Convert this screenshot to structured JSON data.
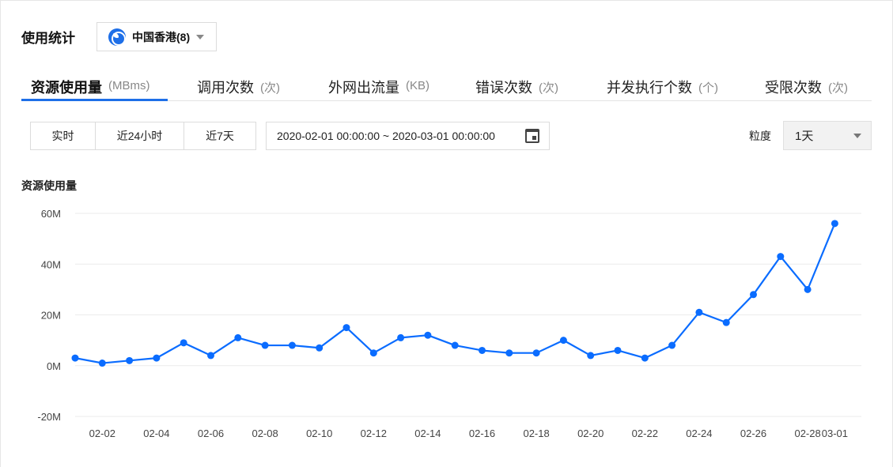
{
  "header": {
    "title": "使用统计"
  },
  "region": {
    "label": "中国香港(8)",
    "icon": "globe-icon"
  },
  "tabs": [
    {
      "label": "资源使用量",
      "unit": "(MBms)",
      "active": true
    },
    {
      "label": "调用次数",
      "unit": "(次)",
      "active": false
    },
    {
      "label": "外网出流量",
      "unit": "(KB)",
      "active": false
    },
    {
      "label": "错误次数",
      "unit": "(次)",
      "active": false
    },
    {
      "label": "并发执行个数",
      "unit": "(个)",
      "active": false
    },
    {
      "label": "受限次数",
      "unit": "(次)",
      "active": false
    }
  ],
  "range_buttons": [
    {
      "label": "实时"
    },
    {
      "label": "近24小时"
    },
    {
      "label": "近7天"
    }
  ],
  "date_range": {
    "value": "2020-02-01 00:00:00 ~ 2020-03-01 00:00:00",
    "icon": "calendar-icon"
  },
  "granularity": {
    "label": "粒度",
    "value": "1天"
  },
  "colors": {
    "accent": "#1e6fe8",
    "line": "#0a6cff",
    "grid": "#ebebeb"
  },
  "chart_data": {
    "type": "line",
    "title": "资源使用量",
    "x_tick_labels": [
      "02-02",
      "02-04",
      "02-06",
      "02-08",
      "02-10",
      "02-12",
      "02-14",
      "02-16",
      "02-18",
      "02-20",
      "02-22",
      "02-24",
      "02-26",
      "02-28",
      "03-01"
    ],
    "y_tick_labels": [
      "60M",
      "40M",
      "20M",
      "0M",
      "-20M"
    ],
    "y_tick_values": [
      60,
      40,
      20,
      0,
      -20
    ],
    "ylim": [
      -20,
      60
    ],
    "y_unit": "M",
    "grid": true,
    "legend": "none",
    "series": [
      {
        "x": [
          "02-01",
          "02-02",
          "02-03",
          "02-04",
          "02-05",
          "02-06",
          "02-07",
          "02-08",
          "02-09",
          "02-10",
          "02-11",
          "02-12",
          "02-13",
          "02-14",
          "02-15",
          "02-16",
          "02-17",
          "02-18",
          "02-19",
          "02-20",
          "02-21",
          "02-22",
          "02-23",
          "02-24",
          "02-25",
          "02-26",
          "02-27",
          "02-28",
          "03-01"
        ],
        "values": [
          3,
          1,
          2,
          3,
          9,
          4,
          11,
          8,
          8,
          7,
          15,
          5,
          11,
          12,
          8,
          6,
          5,
          5,
          10,
          4,
          6,
          3,
          8,
          21,
          17,
          28,
          43,
          30,
          56
        ]
      }
    ]
  }
}
